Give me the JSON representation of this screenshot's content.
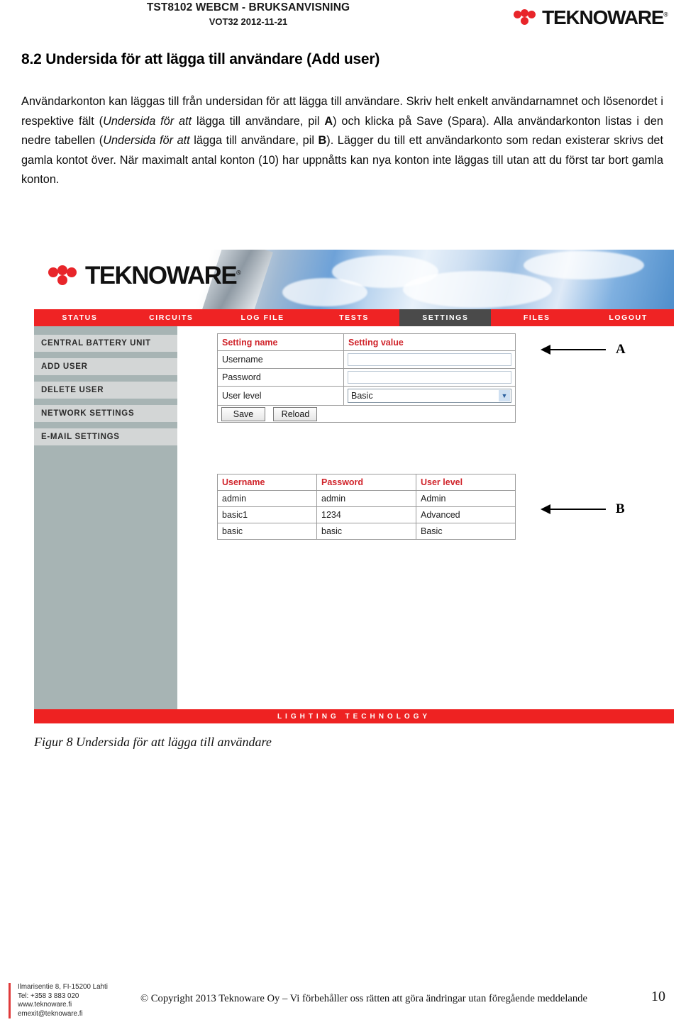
{
  "document_header": {
    "title": "TST8102 WEBCM - BRUKSANVISNING",
    "subtitle": "VOT32 2012-11-21",
    "brand": "TEKNOWARE",
    "brand_registered": "®"
  },
  "section": {
    "heading": "8.2 Undersida för att lägga till användare (Add user)"
  },
  "body": {
    "p1_a": "Användarkonton kan läggas till från undersidan för att lägga till användare. Skriv helt enkelt användarnamnet och lösenordet i respektive fält (",
    "p1_i1": "Undersida för att",
    "p1_b": " lägga till användare, pil ",
    "p1_bold1": "A",
    "p1_c": ") och klicka på Save (Spara). Alla användarkonton listas i den nedre tabellen (",
    "p1_i2": "Undersida för att",
    "p1_d": " lägga till användare, pil ",
    "p1_bold2": "B",
    "p1_e": "). Lägger du till ett användarkonto som redan existerar skrivs det gamla kontot över. När maximalt antal konton (10) har uppnåtts kan nya konton inte läggas till utan att du först tar bort gamla konton."
  },
  "figure": {
    "caption": "Figur 8 Undersida för att lägga till användare",
    "brand": "TEKNOWARE",
    "brand_registered": "®",
    "nav": [
      {
        "label": "STATUS",
        "active": false
      },
      {
        "label": "CIRCUITS",
        "active": false
      },
      {
        "label": "LOG FILE",
        "active": false
      },
      {
        "label": "TESTS",
        "active": false
      },
      {
        "label": "SETTINGS",
        "active": true
      },
      {
        "label": "FILES",
        "active": false
      },
      {
        "label": "LOGOUT",
        "active": false
      }
    ],
    "sidebar": [
      {
        "label": "CENTRAL BATTERY UNIT"
      },
      {
        "label": "ADD USER"
      },
      {
        "label": "DELETE USER"
      },
      {
        "label": "NETWORK SETTINGS"
      },
      {
        "label": "E-MAIL SETTINGS"
      }
    ],
    "settings_table": {
      "header": {
        "name": "Setting name",
        "value": "Setting value"
      },
      "rows": [
        {
          "name": "Username",
          "type": "text",
          "value": ""
        },
        {
          "name": "Password",
          "type": "text",
          "value": ""
        },
        {
          "name": "User level",
          "type": "select",
          "value": "Basic"
        }
      ],
      "buttons": {
        "save": "Save",
        "reload": "Reload"
      },
      "chevron": "▼"
    },
    "users_table": {
      "headers": [
        "Username",
        "Password",
        "User level"
      ],
      "rows": [
        [
          "admin",
          "admin",
          "Admin"
        ],
        [
          "basic1",
          "1234",
          "Advanced"
        ],
        [
          "basic",
          "basic",
          "Basic"
        ]
      ]
    },
    "footer_strip": "LIGHTING TECHNOLOGY",
    "annotations": {
      "a": "A",
      "b": "B"
    }
  },
  "page_footer": {
    "address": "Ilmarisentie 8, FI-15200 Lahti",
    "tel": "Tel: +358 3 883 020",
    "web": "www.teknoware.fi",
    "email": "emexit@teknoware.fi",
    "copyright": "© Copyright 2013 Teknoware Oy – Vi förbehåller oss rätten att göra ändringar utan föregående meddelande",
    "page_number": "10"
  },
  "colors": {
    "brand_red": "#e8252a",
    "nav_red": "#ef2324",
    "nav_active": "#4a4a4a",
    "sidebar_bg": "#a7b4b4",
    "sidebar_item": "#d3d6d6",
    "table_header_red": "#d0242b"
  }
}
